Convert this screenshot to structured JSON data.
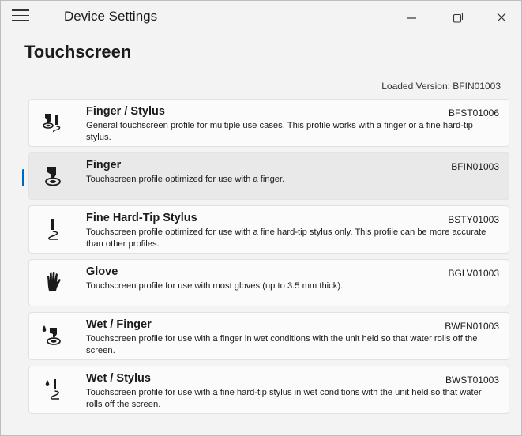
{
  "app": {
    "title": "Device Settings"
  },
  "page": {
    "title": "Touchscreen",
    "loaded_version": "Loaded Version: BFIN01003"
  },
  "profiles": [
    {
      "name": "Finger / Stylus",
      "code": "BFST01006",
      "description": "General touchscreen profile for multiple use cases. This profile works with a finger or a fine hard-tip stylus.",
      "icon": "finger-stylus-icon",
      "selected": false
    },
    {
      "name": "Finger",
      "code": "BFIN01003",
      "description": "Touchscreen profile optimized for use with a finger.",
      "icon": "finger-icon",
      "selected": true
    },
    {
      "name": "Fine Hard-Tip Stylus",
      "code": "BSTY01003",
      "description": "Touchscreen profile optimized for use with a fine hard-tip stylus only. This profile can be more accurate than other profiles.",
      "icon": "stylus-icon",
      "selected": false
    },
    {
      "name": "Glove",
      "code": "BGLV01003",
      "description": "Touchscreen profile for use with most gloves (up to 3.5 mm thick).",
      "icon": "glove-icon",
      "selected": false
    },
    {
      "name": "Wet / Finger",
      "code": "BWFN01003",
      "description": "Touchscreen profile for use with a finger in wet conditions with the unit held so that water rolls off the screen.",
      "icon": "wet-finger-icon",
      "selected": false
    },
    {
      "name": "Wet / Stylus",
      "code": "BWST01003",
      "description": "Touchscreen profile for use with a fine hard-tip stylus in wet conditions with the unit held so that water rolls off the screen.",
      "icon": "wet-stylus-icon",
      "selected": false
    }
  ],
  "colors": {
    "accent": "#0067c0",
    "background": "#f3f3f3",
    "card": "#fbfbfb",
    "selected_card": "#e9e9e9"
  }
}
